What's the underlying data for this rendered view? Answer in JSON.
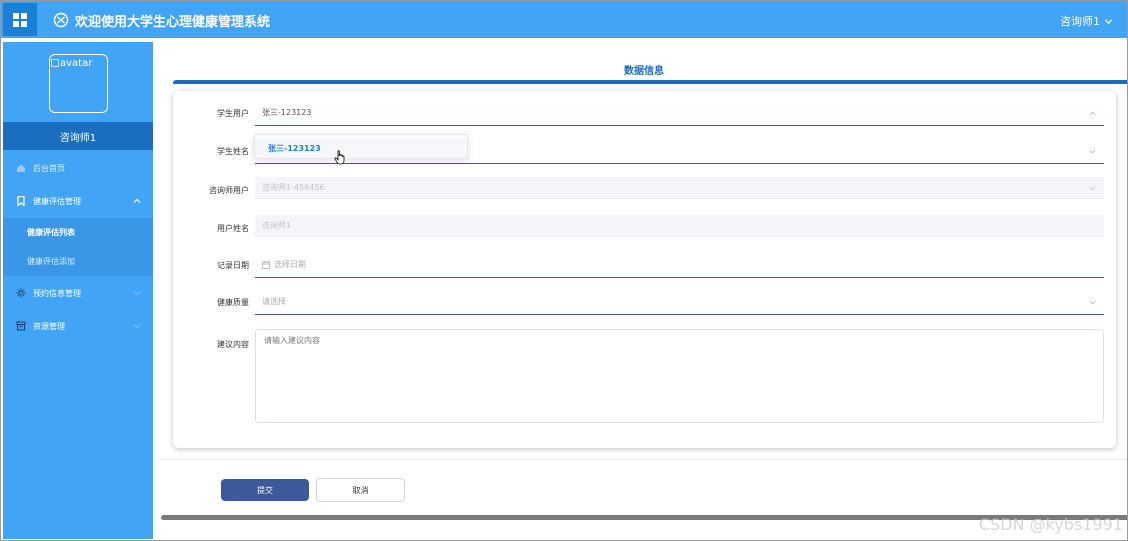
{
  "header": {
    "title": "欢迎使用大学生心理健康管理系统",
    "user": "咨询师1"
  },
  "sidebar": {
    "avatar_alt": "avatar",
    "role": "咨询师1",
    "items": [
      {
        "label": "后台首页"
      },
      {
        "label": "健康评估管理",
        "submenu": [
          {
            "label": "健康评估列表"
          },
          {
            "label": "健康评估添加"
          }
        ]
      },
      {
        "label": "预约信息管理"
      },
      {
        "label": "资源管理"
      }
    ]
  },
  "main": {
    "section_title": "数据信息",
    "form": {
      "student_user": {
        "label": "学生用户",
        "value": "张三-123123"
      },
      "student_name": {
        "label": "学生姓名",
        "value": ""
      },
      "counselor_user": {
        "label": "咨询师用户",
        "value": "咨询师1-456456"
      },
      "user_name": {
        "label": "用户姓名",
        "value": "咨询师1"
      },
      "record_date": {
        "label": "记录日期",
        "placeholder": "选择日期"
      },
      "health_quality": {
        "label": "健康质量",
        "placeholder": "请选择"
      },
      "advice": {
        "label": "建议内容",
        "placeholder": "请输入建议内容"
      }
    },
    "dropdown_option": "张三-123123",
    "submit_label": "提交",
    "cancel_label": "取消"
  },
  "watermark": "CSDN @kybs1991",
  "colors": {
    "header_bg": "#42a4f5",
    "sidebar_bg": "#42a4f5",
    "accent_dark": "#1a6dbf",
    "primary_button": "#3c5a9a",
    "option_text": "#1a7fd6"
  }
}
